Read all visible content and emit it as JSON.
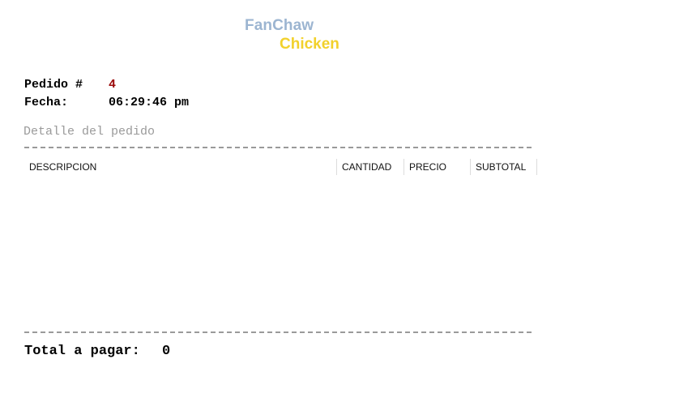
{
  "brand": {
    "line1": "FanChaw",
    "line2": "Chicken",
    "line1_color": "#9cb5d1",
    "line2_color": "#f2d12c"
  },
  "order": {
    "number_label": "Pedido #",
    "number_value": "4",
    "date_label": "Fecha:",
    "date_value": "06:29:46 pm",
    "number_value_color": "#9b0a0a"
  },
  "details": {
    "title": "Detalle del pedido",
    "columns": [
      "DESCRIPCION",
      "CANTIDAD",
      "PRECIO",
      "SUBTOTAL"
    ],
    "rows": []
  },
  "total": {
    "label": "Total a pagar:",
    "value": "0"
  }
}
